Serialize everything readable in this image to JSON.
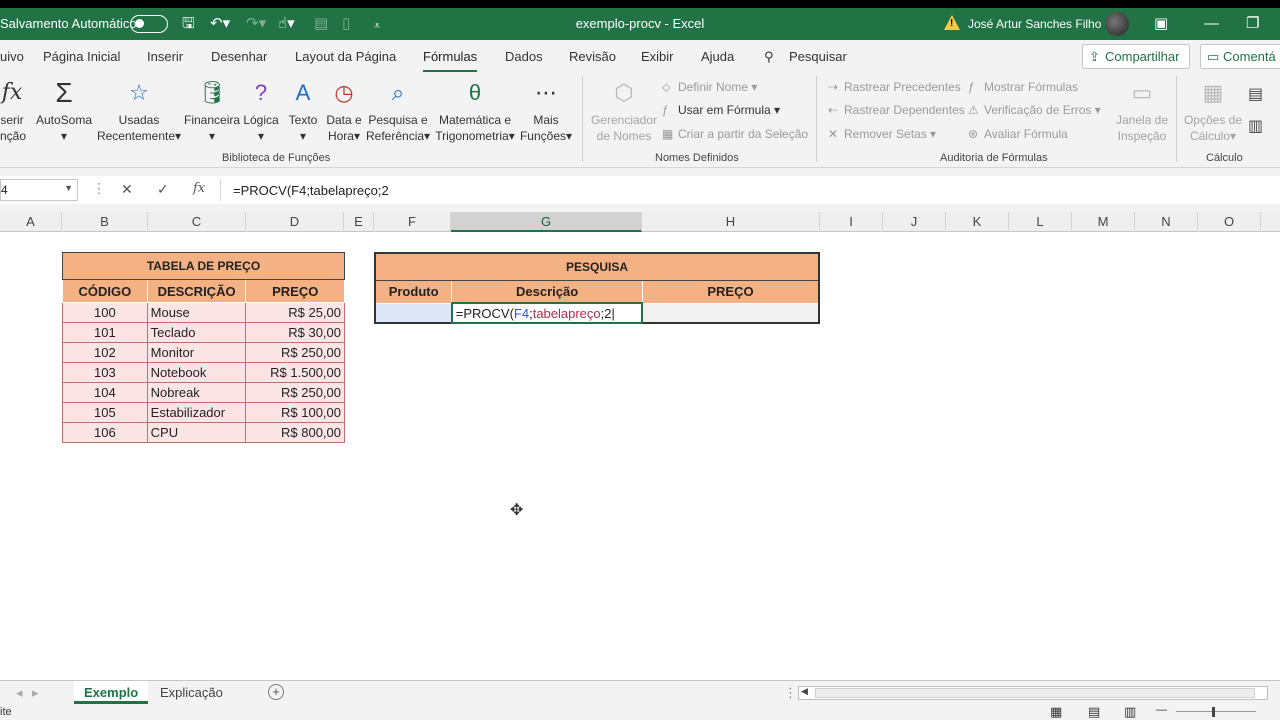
{
  "titlebar": {
    "autosave_label": "Salvamento Automático",
    "doc_title": "exemplo-procv  -  Excel",
    "user_name": "José Artur Sanches Filho"
  },
  "menubar": {
    "tabs": [
      "uivo",
      "Página Inicial",
      "Inserir",
      "Desenhar",
      "Layout da Página",
      "Fórmulas",
      "Dados",
      "Revisão",
      "Exibir",
      "Ajuda",
      "Pesquisar"
    ],
    "share": "Compartilhar",
    "comments": "Comentá"
  },
  "ribbon": {
    "insert_fn": [
      "serir",
      "nção"
    ],
    "autosum": "AutoSoma",
    "recent": [
      "Usadas",
      "Recentemente"
    ],
    "financial": "Financeira",
    "logical": "Lógica",
    "text": "Texto",
    "datetime": [
      "Data e",
      "Hora"
    ],
    "lookup": [
      "Pesquisa e",
      "Referência"
    ],
    "math": [
      "Matemática e",
      "Trigonometria"
    ],
    "more": [
      "Mais",
      "Funções"
    ],
    "group_library": "Biblioteca de Funções",
    "name_manager": [
      "Gerenciador",
      "de Nomes"
    ],
    "define_name": "Definir Nome",
    "use_in_formula": "Usar em Fórmula",
    "create_from_sel": "Criar a partir da Seleção",
    "group_names": "Nomes Definidos",
    "trace_prec": "Rastrear Precedentes",
    "trace_dep": "Rastrear Dependentes",
    "remove_arrows": "Remover Setas",
    "show_formulas": "Mostrar Fórmulas",
    "error_check": "Verificação de Erros",
    "evaluate": "Avaliar Fórmula",
    "watch": [
      "Janela de",
      "Inspeção"
    ],
    "group_audit": "Auditoria de Fórmulas",
    "calc_options": [
      "Opções de",
      "Cálculo"
    ],
    "group_calc": "Cálculo"
  },
  "formulabar": {
    "namebox": "4",
    "formula": "=PROCV(F4;tabelapreço;2"
  },
  "columns": [
    "A",
    "B",
    "C",
    "D",
    "E",
    "F",
    "G",
    "H",
    "I",
    "J",
    "K",
    "L",
    "M",
    "N",
    "O"
  ],
  "price_table": {
    "title": "TABELA DE PREÇO",
    "headers": [
      "CÓDIGO",
      "DESCRIÇÃO",
      "PREÇO"
    ],
    "rows": [
      [
        "100",
        "Mouse",
        "R$ 25,00"
      ],
      [
        "101",
        "Teclado",
        "R$ 30,00"
      ],
      [
        "102",
        "Monitor",
        "R$ 250,00"
      ],
      [
        "103",
        "Notebook",
        "R$ 1.500,00"
      ],
      [
        "104",
        "Nobreak",
        "R$ 250,00"
      ],
      [
        "105",
        "Estabilizador",
        "R$ 100,00"
      ],
      [
        "106",
        "CPU",
        "R$ 800,00"
      ]
    ]
  },
  "search_table": {
    "title": "PESQUISA",
    "headers": [
      "Produto",
      "Descrição",
      "PREÇO"
    ],
    "formula_prefix": "=PROCV(",
    "formula_ref": "F4",
    "formula_sep1": ";",
    "formula_name": "tabelapreço",
    "formula_rest": ";2"
  },
  "sheets": [
    "Exemplo",
    "Explicação"
  ],
  "status": "ite",
  "colors": {
    "excel_green": "#217346",
    "header_orange": "#f4b183",
    "row_pink": "#fbe4e4"
  }
}
